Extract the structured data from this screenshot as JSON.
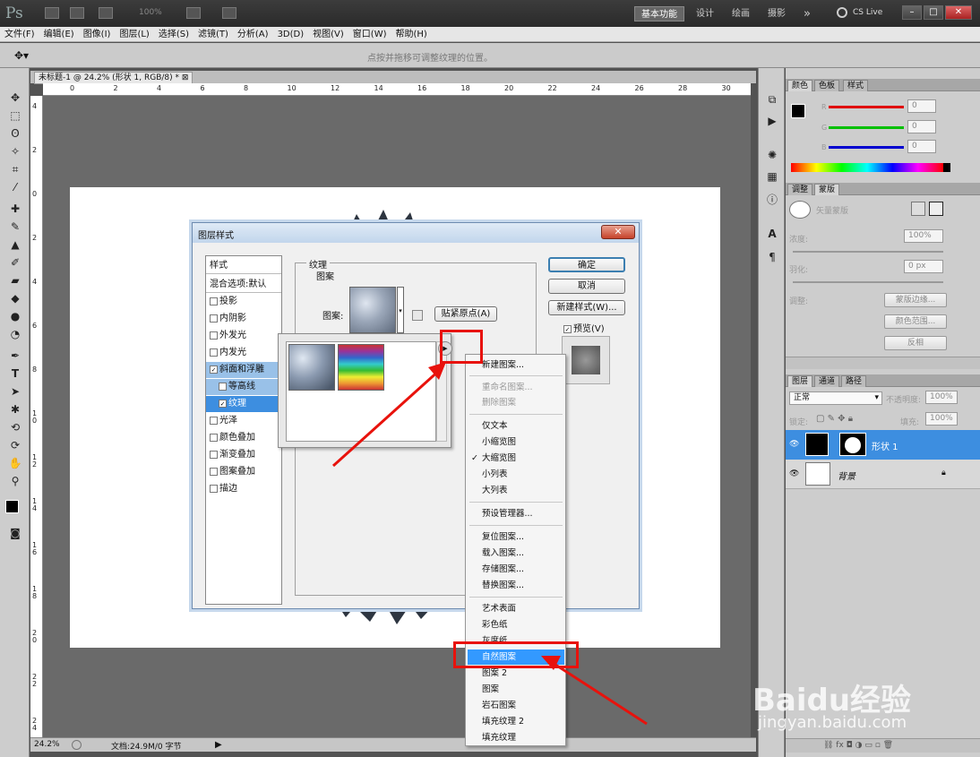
{
  "app": {
    "logo": "Ps",
    "zoom_option": "100%",
    "workspaces": [
      "基本功能",
      "设计",
      "绘画",
      "摄影"
    ],
    "more": "»",
    "cslive": "CS Live",
    "win_buttons": [
      "–",
      "□",
      "✕"
    ]
  },
  "menu": [
    "文件(F)",
    "编辑(E)",
    "图像(I)",
    "图层(L)",
    "选择(S)",
    "滤镜(T)",
    "分析(A)",
    "3D(D)",
    "视图(V)",
    "窗口(W)",
    "帮助(H)"
  ],
  "options": {
    "hint": "点按并拖移可调整纹理的位置。"
  },
  "document": {
    "tab": "未标题-1 @ 24.2% (形状 1, RGB/8) *",
    "ruler_h": [
      "0",
      "2",
      "4",
      "6",
      "8",
      "10",
      "12",
      "14",
      "16",
      "18",
      "20",
      "22",
      "24",
      "26",
      "28",
      "30"
    ],
    "ruler_v": [
      "4",
      "2",
      "0",
      "2",
      "4",
      "6",
      "8",
      "1\n0",
      "1\n2",
      "1\n4",
      "1\n6",
      "1\n8",
      "2\n0",
      "2\n2",
      "2\n4"
    ],
    "zoom": "24.2%",
    "doc_info": "文档:24.9M/0 字节"
  },
  "dialog": {
    "title": "图层样式",
    "close": "✕",
    "styles_header": "样式",
    "blend_default": "混合选项:默认",
    "style_items": [
      {
        "label": "投影",
        "checked": false
      },
      {
        "label": "内阴影",
        "checked": false
      },
      {
        "label": "外发光",
        "checked": false
      },
      {
        "label": "内发光",
        "checked": false
      },
      {
        "label": "斜面和浮雕",
        "checked": true
      },
      {
        "label": "等高线",
        "checked": false
      },
      {
        "label": "纹理",
        "checked": true
      },
      {
        "label": "光泽",
        "checked": false
      },
      {
        "label": "颜色叠加",
        "checked": false
      },
      {
        "label": "渐变叠加",
        "checked": false
      },
      {
        "label": "图案叠加",
        "checked": false
      },
      {
        "label": "描边",
        "checked": false
      }
    ],
    "texture_group": "纹理",
    "pattern_group": "图案",
    "pattern_label": "图案:",
    "snap_origin": "贴紧原点(A)",
    "buttons": {
      "ok": "确定",
      "cancel": "取消",
      "new_style": "新建样式(W)..."
    },
    "preview_label": "预览(V)",
    "preview_checked": true
  },
  "context_menu": {
    "groups": [
      [
        {
          "label": "新建图案...",
          "disabled": false
        }
      ],
      [
        {
          "label": "重命名图案...",
          "disabled": true
        },
        {
          "label": "删除图案",
          "disabled": true
        }
      ],
      [
        {
          "label": "仅文本"
        },
        {
          "label": "小缩览图"
        },
        {
          "label": "大缩览图",
          "checked": true
        },
        {
          "label": "小列表"
        },
        {
          "label": "大列表"
        }
      ],
      [
        {
          "label": "预设管理器..."
        }
      ],
      [
        {
          "label": "复位图案..."
        },
        {
          "label": "载入图案..."
        },
        {
          "label": "存储图案..."
        },
        {
          "label": "替换图案..."
        }
      ],
      [
        {
          "label": "艺术表面"
        },
        {
          "label": "彩色纸"
        },
        {
          "label": "灰度纸"
        },
        {
          "label": "自然图案",
          "highlighted": true
        },
        {
          "label": "图案 2"
        },
        {
          "label": "图案"
        },
        {
          "label": "岩石图案"
        },
        {
          "label": "填充纹理 2"
        },
        {
          "label": "填充纹理"
        }
      ]
    ]
  },
  "color_panel": {
    "tabs": [
      "颜色",
      "色板",
      "样式"
    ],
    "channels": [
      {
        "label": "R",
        "value": "0",
        "color": "#e00000"
      },
      {
        "label": "G",
        "value": "0",
        "color": "#00c000"
      },
      {
        "label": "B",
        "value": "0",
        "color": "#0000d0"
      }
    ]
  },
  "adjust_panel": {
    "tabs": [
      "调整",
      "蒙版"
    ],
    "mask_label": "矢量蒙版",
    "density_label": "浓度:",
    "density_value": "100%",
    "feather_label": "羽化:",
    "feather_value": "0 px",
    "refine_label": "调整:",
    "buttons": [
      "蒙版边缘...",
      "颜色范围...",
      "反相"
    ]
  },
  "layers_panel": {
    "tabs": [
      "图层",
      "通道",
      "路径"
    ],
    "blend_mode": "正常",
    "opacity_label": "不透明度:",
    "opacity_value": "100%",
    "lock_label": "锁定:",
    "fill_label": "填充:",
    "fill_value": "100%",
    "layers": [
      {
        "name": "形状 1",
        "selected": true
      },
      {
        "name": "背景",
        "selected": false
      }
    ]
  },
  "watermark": {
    "brand": "Baidu经验",
    "url": "jingyan.baidu.com"
  },
  "colors": {
    "accent": "#3d8ee0",
    "highlight": "#3399ff",
    "annotation": "#e8120c"
  }
}
